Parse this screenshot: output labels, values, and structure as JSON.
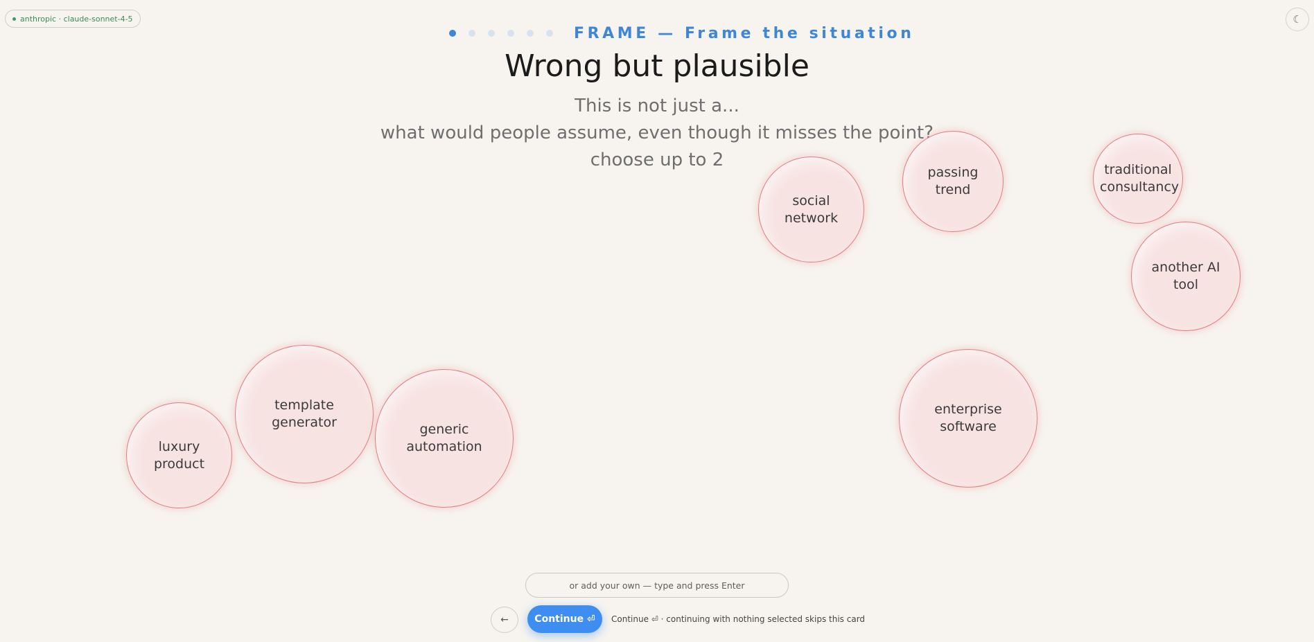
{
  "model_badge": {
    "label": "anthropic · claude-sonnet-4-5"
  },
  "theme_toggle": {
    "icon": "moon-icon",
    "glyph": "☾"
  },
  "progress": {
    "total_steps": 6,
    "current_step": 1,
    "step_label": "FRAME — Frame the situation"
  },
  "header": {
    "title": "Wrong but plausible",
    "subtitle_line1": "This is not just a...",
    "subtitle_line2": "what would people assume, even though it misses the point?",
    "subtitle_line3": "choose up to 2"
  },
  "options": [
    {
      "label": "social network",
      "selected": false
    },
    {
      "label": "passing trend",
      "selected": false
    },
    {
      "label": "traditional consultancy",
      "selected": false
    },
    {
      "label": "another AI tool",
      "selected": false
    },
    {
      "label": "template generator",
      "selected": false
    },
    {
      "label": "generic automation",
      "selected": false
    },
    {
      "label": "luxury product",
      "selected": false
    },
    {
      "label": "enterprise software",
      "selected": false
    }
  ],
  "custom_input": {
    "placeholder": "or add your own — type and press Enter",
    "value": ""
  },
  "footer": {
    "back_glyph": "←",
    "continue_label": "Continue ⏎",
    "hint": "Continue ⏎ · continuing with nothing selected skips this card"
  },
  "colors": {
    "accent": "#3d86d8",
    "bubble_border": "#e07e82",
    "bubble_fill": "#f7e3e2",
    "background": "#f7f4ef"
  }
}
